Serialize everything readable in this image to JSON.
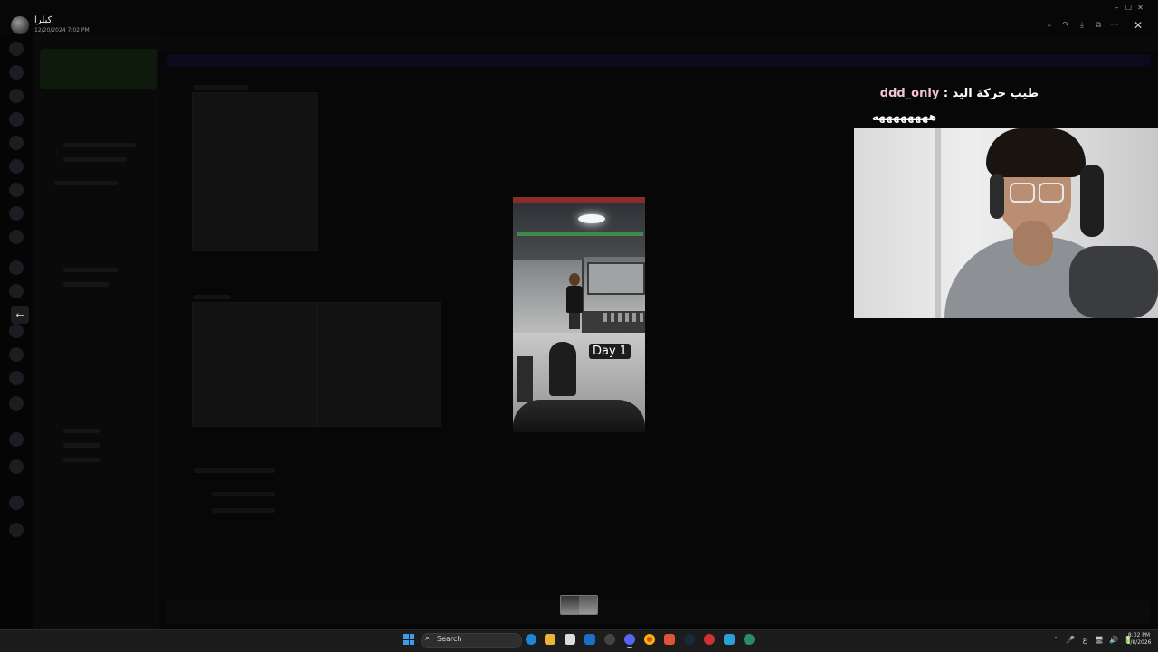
{
  "viewer": {
    "uploader_name": "كيلرا",
    "upload_date": "12/20/2024 7:02 PM",
    "tools": [
      {
        "icon": "zoom-icon",
        "glyph": "⌕"
      },
      {
        "icon": "forward-icon",
        "glyph": "↷"
      },
      {
        "icon": "download-icon",
        "glyph": "⤓"
      },
      {
        "icon": "open-external-icon",
        "glyph": "⧉"
      },
      {
        "icon": "more-icon",
        "glyph": "⋯"
      }
    ],
    "close_glyph": "✕",
    "prev_glyph": "←",
    "image_caption": "Day 1"
  },
  "window_controls": {
    "minimize": "–",
    "maximize": "☐",
    "close": "✕"
  },
  "stream": {
    "chat_user": "ddd_only",
    "chat_message": "طيب حركة اليد :",
    "chat_line2": "ههههههههه"
  },
  "taskbar": {
    "search_label": "Search",
    "search_glyph": "⌕",
    "clock_time": "8:02 PM",
    "clock_date": "1/8/2026",
    "tray": [
      "⌃",
      "🎤",
      "ع",
      "🖥",
      "🔊",
      "🔋"
    ]
  }
}
